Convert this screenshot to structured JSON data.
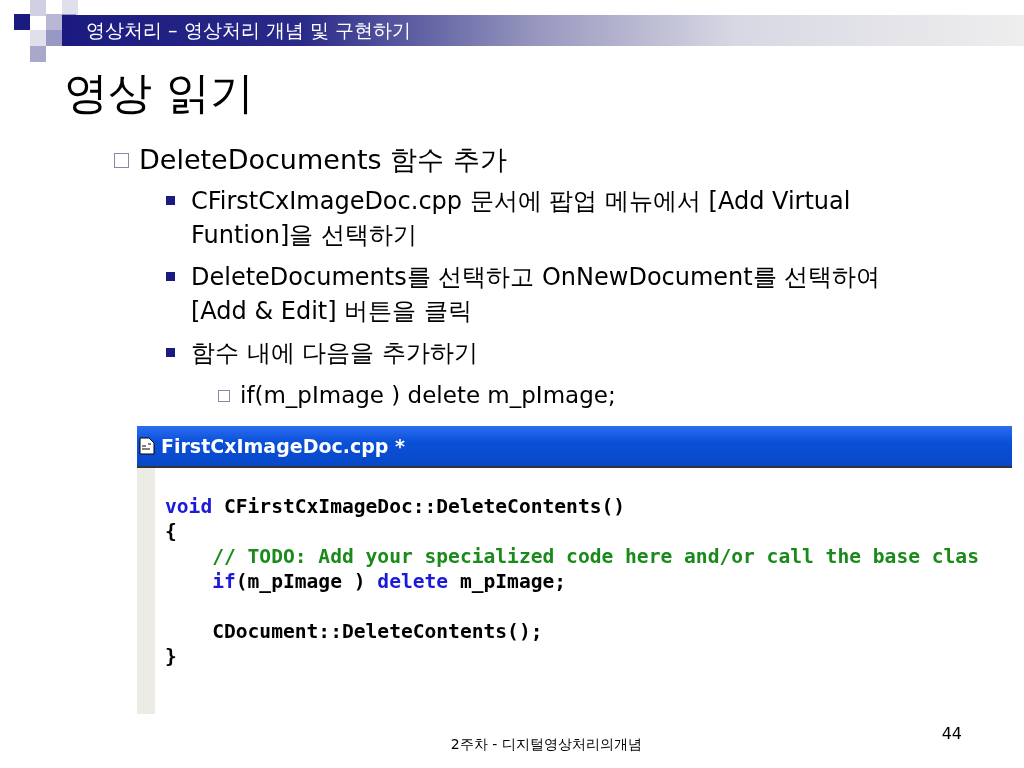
{
  "header": {
    "section": "영상처리 – 영상처리 개념 및 구현하기"
  },
  "title": "영상 읽기",
  "bullets": [
    {
      "kind": "hollow",
      "text": "DeleteDocuments 함수 추가",
      "children": [
        {
          "kind": "solid",
          "text": "CFirstCxImageDoc.cpp 문서에 팝업 메뉴에서 [Add Virtual Funtion]을 선택하기"
        },
        {
          "kind": "solid",
          "text": "DeleteDocuments를 선택하고 OnNewDocument를 선택하여 [Add & Edit] 버튼을 클릭"
        },
        {
          "kind": "solid",
          "text": "함수 내에 다음을 추가하기",
          "children": [
            {
              "kind": "hollow",
              "text": "if(m_pImage ) delete m_pImage;"
            }
          ]
        }
      ]
    }
  ],
  "editor": {
    "title": "FirstCxImageDoc.cpp *",
    "lines": [
      {
        "kind": "code",
        "tokens": [
          {
            "kind": "keyword",
            "text": "void"
          },
          {
            "kind": "plain",
            "text": " CFirstCxImageDoc::DeleteContents()"
          }
        ]
      },
      {
        "kind": "code",
        "tokens": [
          {
            "kind": "plain",
            "text": "{"
          }
        ]
      },
      {
        "kind": "code",
        "tokens": [
          {
            "kind": "comment",
            "text": "    // TODO: Add your specialized code here and/or call the base clas"
          }
        ]
      },
      {
        "kind": "code",
        "tokens": [
          {
            "kind": "keyword",
            "text": "    if"
          },
          {
            "kind": "plain",
            "text": "(m_pImage ) "
          },
          {
            "kind": "keyword",
            "text": "delete"
          },
          {
            "kind": "plain",
            "text": " m_pImage;"
          }
        ]
      },
      {
        "kind": "blank"
      },
      {
        "kind": "code",
        "tokens": [
          {
            "kind": "plain",
            "text": "    CDocument::DeleteContents();"
          }
        ]
      },
      {
        "kind": "code",
        "tokens": [
          {
            "kind": "plain",
            "text": "}"
          }
        ]
      }
    ]
  },
  "footer": {
    "course": "2주차 - 디지털영상처리의개념",
    "page": "44"
  }
}
